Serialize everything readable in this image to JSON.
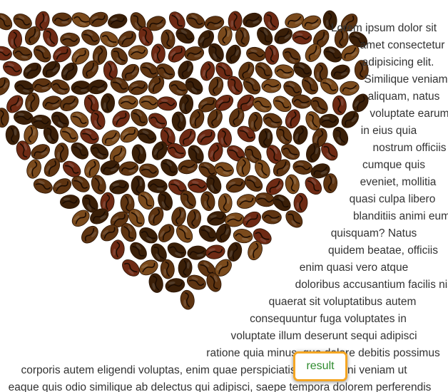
{
  "colors": {
    "bean_dark": "#3a1f08",
    "bean_mid": "#5e3411",
    "bean_light": "#7a4a1c",
    "bean_red": "#6e2a14",
    "text": "#333333",
    "button_text": "#2e8b2e",
    "button_border": "#f5a623"
  },
  "heart": {
    "image_name": "coffee-beans-heart"
  },
  "text_lines": [
    "Lorem ipsum dolor sit",
    "amet consectetur",
    "adipisicing elit.",
    "Similique veniam",
    "aliquam, natus",
    "voluptate earum",
    "in eius quia",
    "nostrum officiis",
    "cumque quis",
    "eveniet, mollitia",
    "quasi culpa libero",
    "blanditiis animi eum",
    "quisquam? Natus",
    "quidem beatae, officiis",
    "enim quasi vero atque",
    "doloribus accusantium facilis nisi",
    "quaerat sit voluptatibus autem",
    "consequuntur fuga voluptates in",
    "voluptate illum deserunt sequi adipisci",
    "ratione quia minus, quo dolore debitis possimus",
    "corporis autem eligendi voluptas, enim quae perspiciatis quas magni veniam ut",
    "eaque quis odio similique ab delectus qui adipisci, saepe tempora dolorem perferendis"
  ],
  "button": {
    "label": "result"
  }
}
